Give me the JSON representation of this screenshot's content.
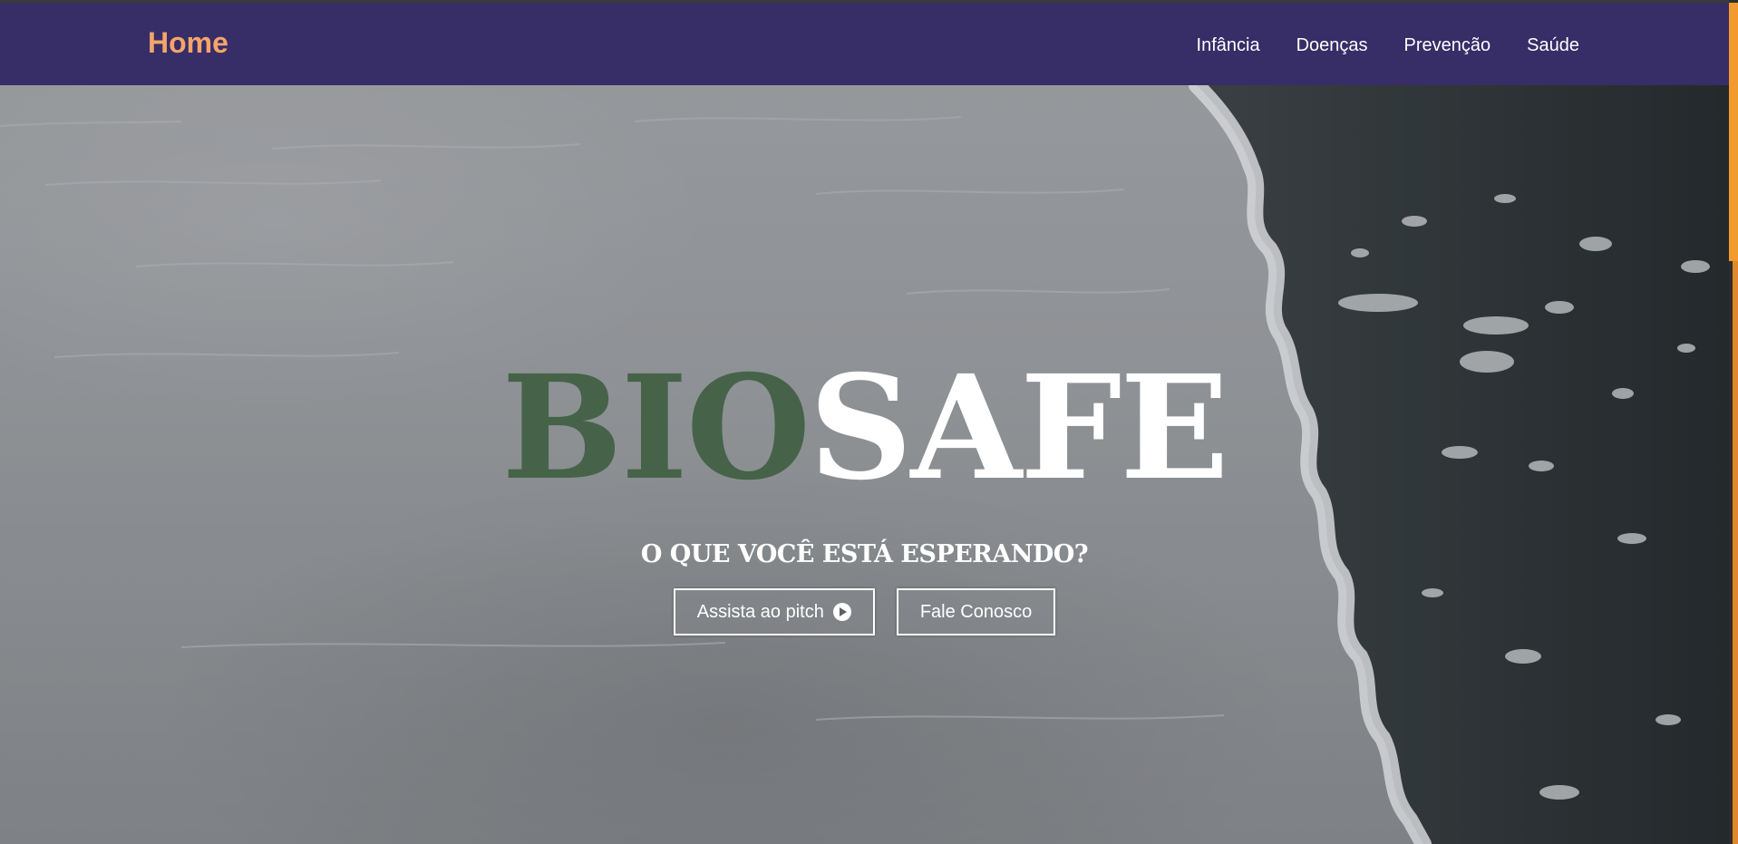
{
  "navbar": {
    "brand": "Home",
    "links": [
      "Infância",
      "Doenças",
      "Prevenção",
      "Saúde"
    ]
  },
  "hero": {
    "title_part1": "BIO",
    "title_part2": "SAFE",
    "subtitle": "O QUE VOCÊ ESTÁ ESPERANDO?",
    "buttons": {
      "pitch": "Assista ao pitch",
      "contact": "Fale Conosco"
    }
  },
  "colors": {
    "navbar_bg": "#372d67",
    "brand": "#f5a46a",
    "title_bio": "#46634a",
    "title_safe": "#ffffff",
    "scrollbar_accent": "#f29a2c"
  },
  "icons": {
    "pitch_button_icon": "play-circle-icon"
  }
}
